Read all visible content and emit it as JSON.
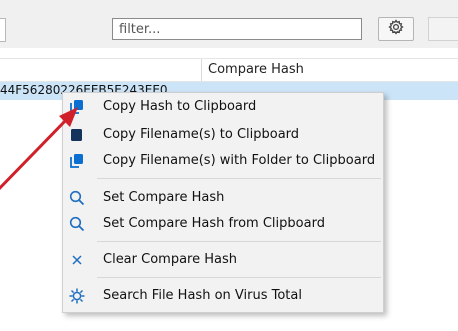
{
  "toolbar": {
    "filter_placeholder": "filter...",
    "settings_icon": "gear-icon"
  },
  "table": {
    "compare_hash_header": "Compare Hash",
    "selected_row_hash": "44F56280226EEB5E243EE0"
  },
  "context_menu": {
    "items": [
      {
        "label": "Copy Hash to Clipboard",
        "icon": "copy-icon"
      },
      {
        "label": "Copy Filename(s) to Clipboard",
        "icon": "copy-icon"
      },
      {
        "label": "Copy Filename(s) with Folder to Clipboard",
        "icon": "copy-icon"
      },
      {
        "label": "Set Compare Hash",
        "icon": "search-icon"
      },
      {
        "label": "Set Compare Hash from Clipboard",
        "icon": "search-icon"
      },
      {
        "label": "Clear Compare Hash",
        "icon": "close-icon"
      },
      {
        "label": "Search File Hash on Virus Total",
        "icon": "virus-icon"
      }
    ]
  },
  "colors": {
    "selection": "#cce4f7",
    "icon_blue": "#0a6fd1",
    "arrow_red": "#d0202a"
  }
}
